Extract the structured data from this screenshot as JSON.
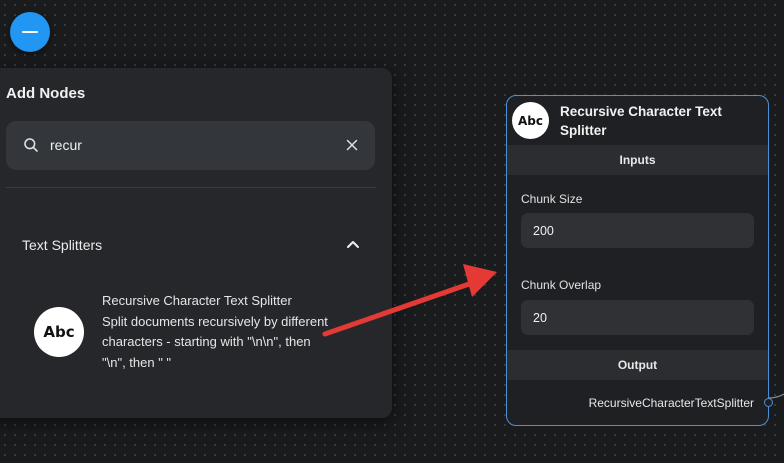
{
  "add_nodes": {
    "title": "Add Nodes",
    "search": {
      "value": "recur",
      "icon": "search-icon",
      "clear_icon": "close-icon"
    },
    "category": {
      "label": "Text Splitters",
      "icon": "chevron-up-icon"
    },
    "item": {
      "avatar": "Abc",
      "name": "Recursive Character Text Splitter",
      "description": "Split documents recursively by different characters - starting with \"\\n\\n\", then \"\\n\", then \" \""
    }
  },
  "node": {
    "avatar": "Abc",
    "title": "Recursive Character Text Splitter",
    "inputs_label": "Inputs",
    "chunk_size_label": "Chunk Size",
    "chunk_size_value": "200",
    "chunk_overlap_label": "Chunk Overlap",
    "chunk_overlap_value": "20",
    "output_label": "Output",
    "output_name": "RecursiveCharacterTextSplitter"
  },
  "colors": {
    "accent": "#2196f3",
    "node_border": "#4a90d8",
    "arrow": "#e53935"
  }
}
